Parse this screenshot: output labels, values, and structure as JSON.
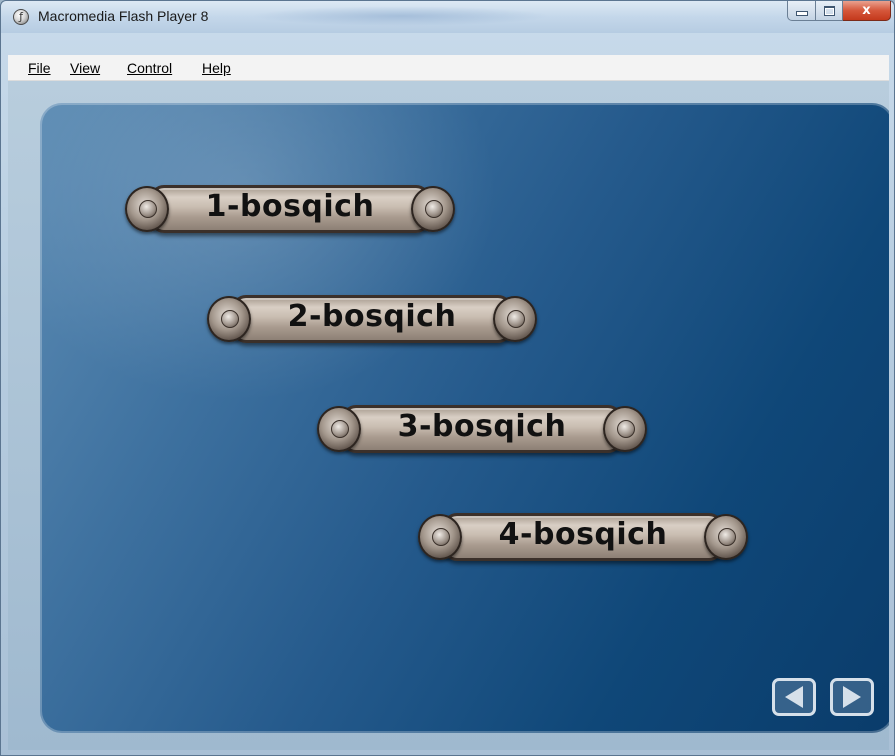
{
  "window": {
    "title": "Macromedia Flash Player 8",
    "close_glyph": "x"
  },
  "menu": {
    "items": [
      {
        "label": "File"
      },
      {
        "label": "View"
      },
      {
        "label": "Control"
      },
      {
        "label": "Help"
      }
    ]
  },
  "stage": {
    "buttons": [
      {
        "label": "1-bosqich"
      },
      {
        "label": "2-bosqich"
      },
      {
        "label": "3-bosqich"
      },
      {
        "label": "4-bosqich"
      }
    ],
    "nav": {
      "prev_icon": "left-arrow-icon",
      "next_icon": "right-arrow-icon"
    }
  },
  "colors": {
    "stage_gradient_start": "#5d8cb4",
    "stage_gradient_end": "#0a3c6b",
    "plaque_metal": "#c9bdb1",
    "close_button": "#c4391c"
  }
}
